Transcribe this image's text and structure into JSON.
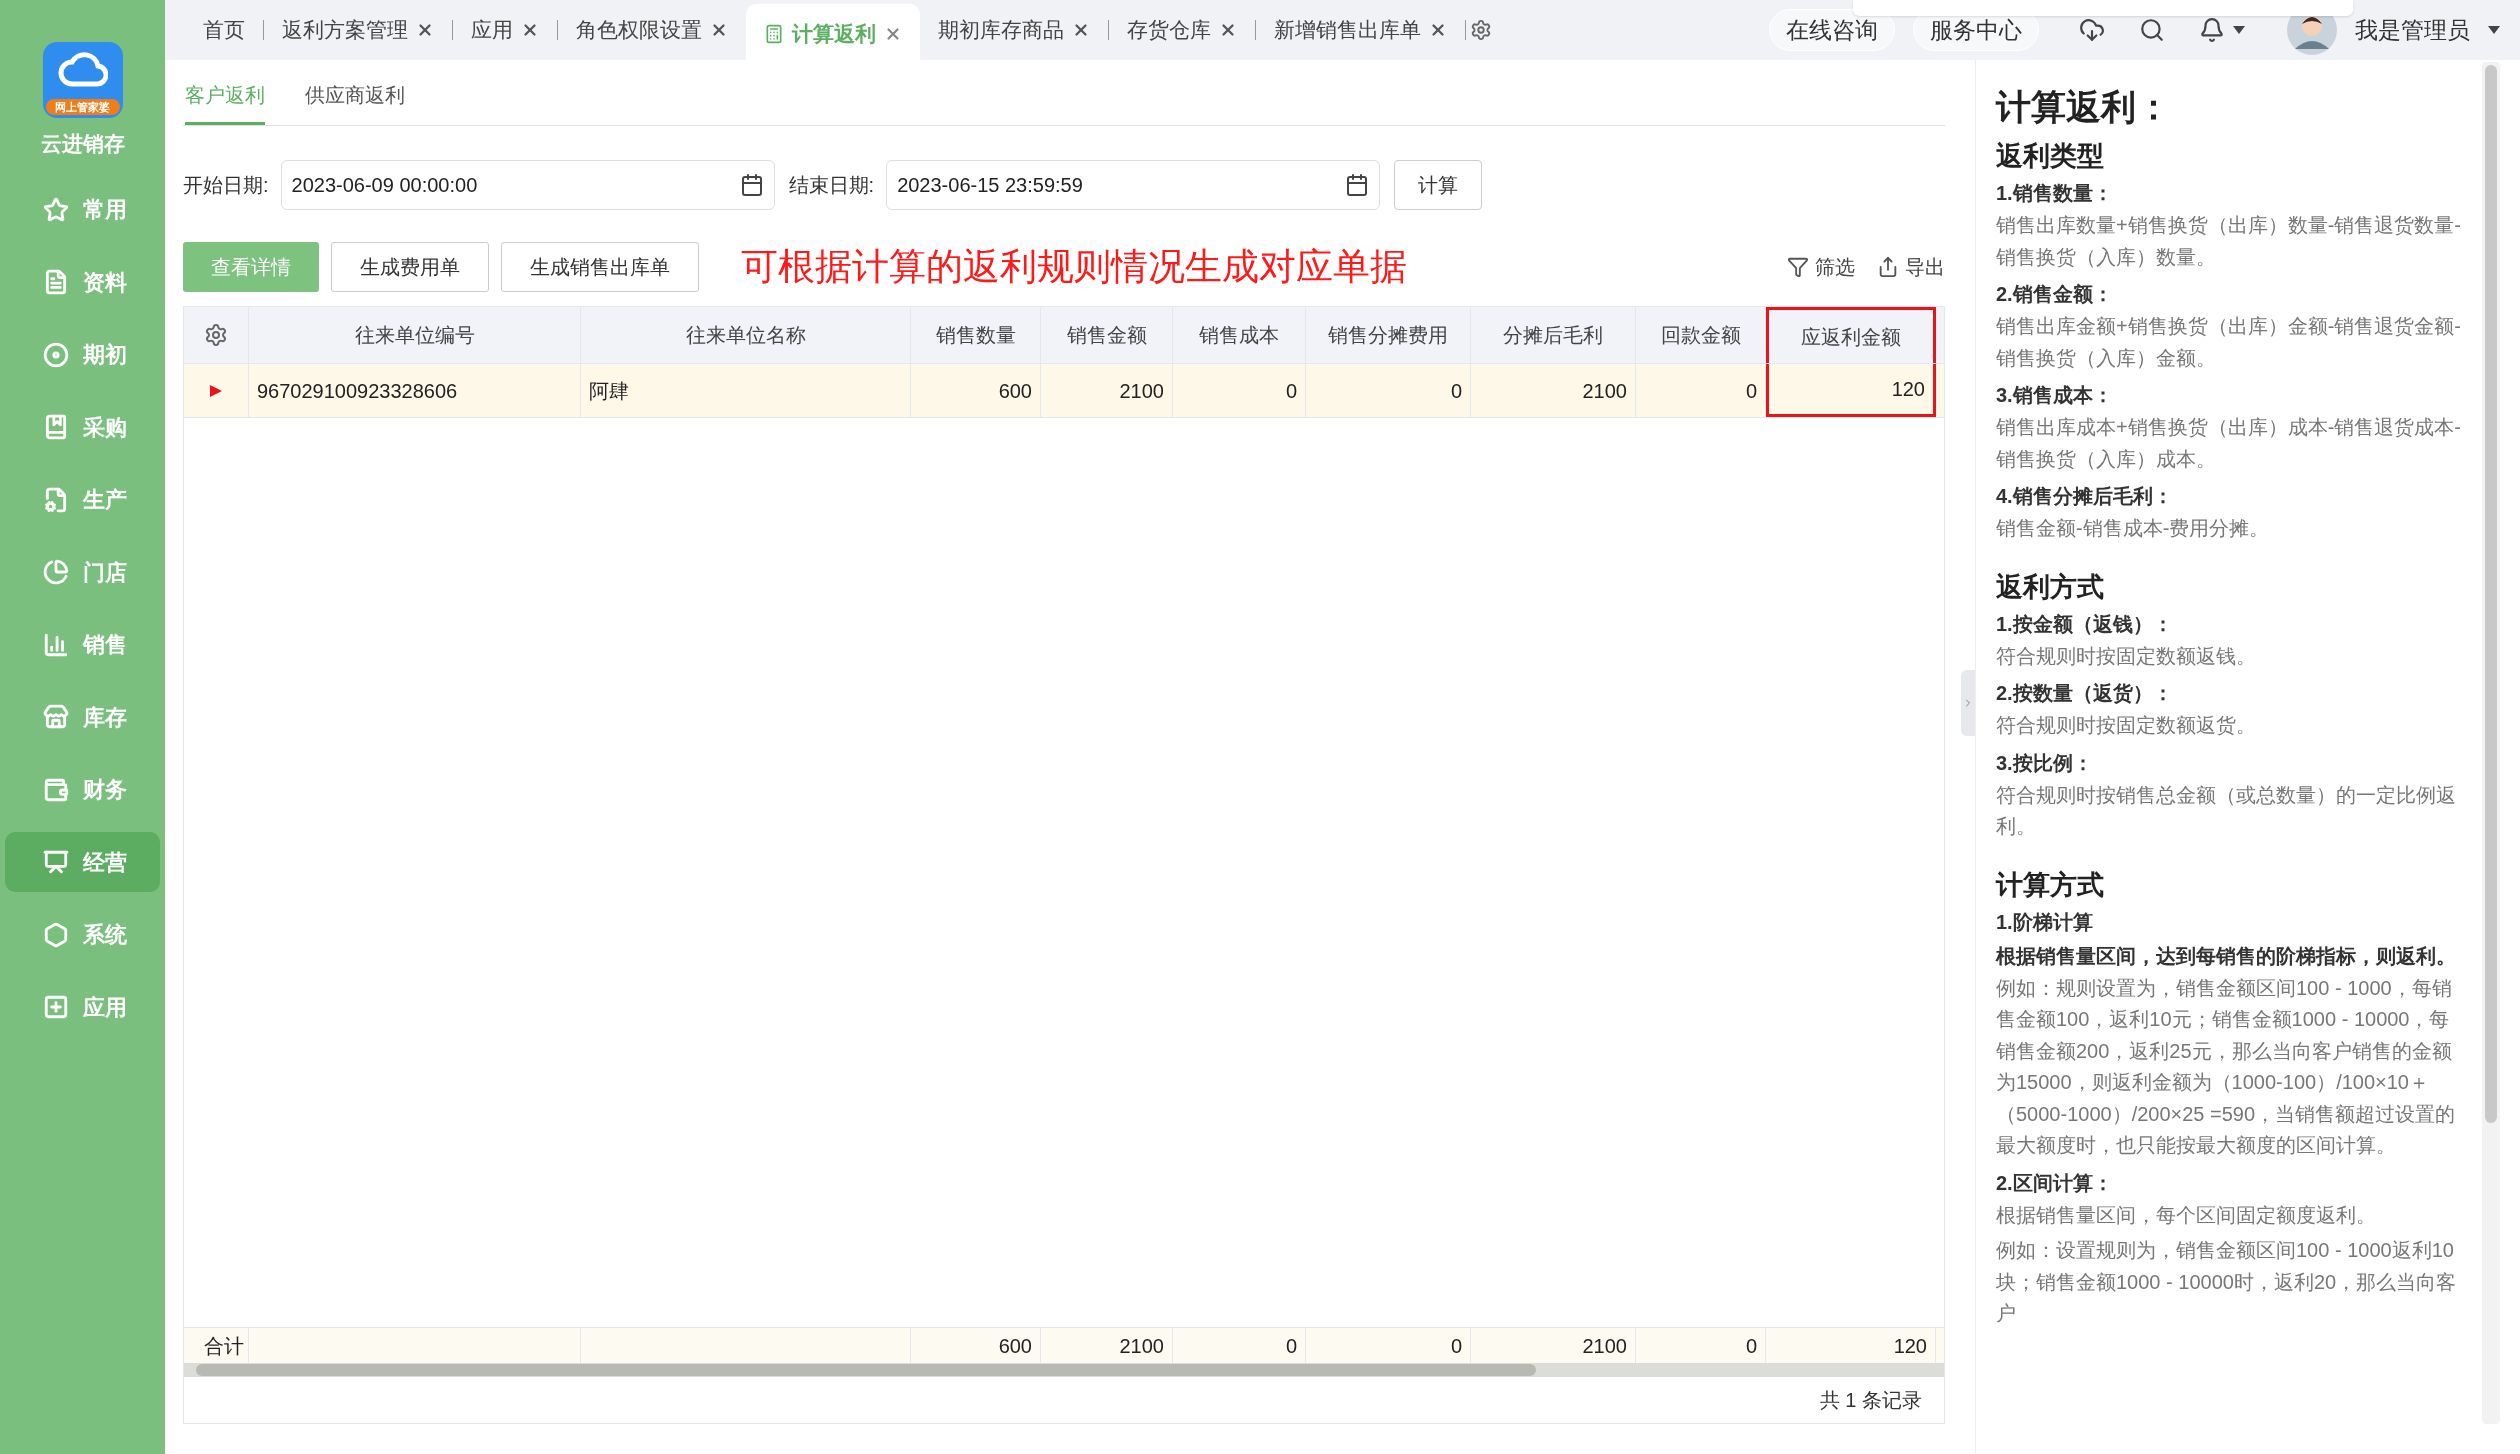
{
  "app": {
    "name": "云进销存",
    "logo_badge": "网上管家婆"
  },
  "nav": [
    {
      "label": "常用",
      "selected": false
    },
    {
      "label": "资料",
      "selected": false
    },
    {
      "label": "期初",
      "selected": false
    },
    {
      "label": "采购",
      "selected": false
    },
    {
      "label": "生产",
      "selected": false
    },
    {
      "label": "门店",
      "selected": false
    },
    {
      "label": "销售",
      "selected": false
    },
    {
      "label": "库存",
      "selected": false
    },
    {
      "label": "财务",
      "selected": false
    },
    {
      "label": "经营",
      "selected": true
    },
    {
      "label": "系统",
      "selected": false
    },
    {
      "label": "应用",
      "selected": false
    }
  ],
  "tabs": [
    {
      "label": "首页",
      "closable": false,
      "selected": false
    },
    {
      "label": "返利方案管理",
      "closable": true,
      "selected": false
    },
    {
      "label": "应用",
      "closable": true,
      "selected": false
    },
    {
      "label": "角色权限设置",
      "closable": true,
      "selected": false
    },
    {
      "label": "计算返利",
      "closable": true,
      "selected": true
    },
    {
      "label": "期初库存商品",
      "closable": true,
      "selected": false
    },
    {
      "label": "存货仓库",
      "closable": true,
      "selected": false
    },
    {
      "label": "新增销售出库单",
      "closable": true,
      "selected": false
    }
  ],
  "header": {
    "consult": "在线咨询",
    "service": "服务中心",
    "user": "我是管理员"
  },
  "subtabs": [
    {
      "label": "客户返利",
      "selected": true
    },
    {
      "label": "供应商返利",
      "selected": false
    }
  ],
  "filters": {
    "start_label": "开始日期:",
    "start_value": "2023-06-09 00:00:00",
    "end_label": "结束日期:",
    "end_value": "2023-06-15 23:59:59",
    "calc_button": "计算"
  },
  "actions": [
    {
      "label": "查看详情",
      "primary": true
    },
    {
      "label": "生成费用单",
      "primary": false
    },
    {
      "label": "生成销售出库单",
      "primary": false
    }
  ],
  "note": "可根据计算的返利规则情况生成对应单据",
  "toolbar": {
    "filter": "筛选",
    "export": "导出"
  },
  "table": {
    "columns": [
      {
        "label": "往来单位编号",
        "numeric": false,
        "highlighted": false
      },
      {
        "label": "往来单位名称",
        "numeric": false,
        "highlighted": false
      },
      {
        "label": "销售数量",
        "numeric": true,
        "highlighted": false
      },
      {
        "label": "销售金额",
        "numeric": true,
        "highlighted": false
      },
      {
        "label": "销售成本",
        "numeric": true,
        "highlighted": false
      },
      {
        "label": "销售分摊费用",
        "numeric": true,
        "highlighted": false
      },
      {
        "label": "分摊后毛利",
        "numeric": true,
        "highlighted": false
      },
      {
        "label": "回款金额",
        "numeric": true,
        "highlighted": false
      },
      {
        "label": "应返利金额",
        "numeric": true,
        "highlighted": true
      }
    ],
    "rows": [
      {
        "selected": true,
        "cells": [
          "967029100923328606",
          "阿肆",
          "600",
          "2100",
          "0",
          "0",
          "2100",
          "0",
          "120"
        ]
      }
    ],
    "totals_label": "合计",
    "totals": [
      "600",
      "2100",
      "0",
      "0",
      "2100",
      "0",
      "120"
    ]
  },
  "record_count": "共 1 条记录",
  "help": {
    "title": "计算返利：",
    "sections": [
      {
        "heading": "返利类型",
        "blocks": [
          {
            "kind": "subhead",
            "text": "1.销售数量："
          },
          {
            "kind": "para",
            "text": "销售出库数量+销售换货（出库）数量-销售退货数量-销售换货（入库）数量。"
          },
          {
            "kind": "subhead",
            "text": "2.销售金额："
          },
          {
            "kind": "para",
            "text": "销售出库金额+销售换货（出库）金额-销售退货金额-销售换货（入库）金额。"
          },
          {
            "kind": "subhead",
            "text": "3.销售成本："
          },
          {
            "kind": "para",
            "text": "销售出库成本+销售换货（出库）成本-销售退货成本-销售换货（入库）成本。"
          },
          {
            "kind": "subhead",
            "text": "4.销售分摊后毛利："
          },
          {
            "kind": "para",
            "text": "销售金额-销售成本-费用分摊。"
          }
        ]
      },
      {
        "heading": "返利方式",
        "blocks": [
          {
            "kind": "subhead",
            "text": "1.按金额（返钱）："
          },
          {
            "kind": "para",
            "text": "符合规则时按固定数额返钱。"
          },
          {
            "kind": "subhead",
            "text": "2.按数量（返货）："
          },
          {
            "kind": "para",
            "text": "符合规则时按固定数额返货。"
          },
          {
            "kind": "subhead",
            "text": "3.按比例："
          },
          {
            "kind": "para",
            "text": "符合规则时按销售总金额（或总数量）的一定比例返利。"
          }
        ]
      },
      {
        "heading": "计算方式",
        "blocks": [
          {
            "kind": "subhead",
            "text": "1.阶梯计算"
          },
          {
            "kind": "subhead",
            "text": "根据销售量区间，达到每销售的阶梯指标，则返利。"
          },
          {
            "kind": "para",
            "text": "例如：规则设置为，销售金额区间100 - 1000，每销售金额100，返利10元；销售金额1000 - 10000，每销售金额200，返利25元，那么当向客户销售的金额为15000，则返利金额为（1000-100）/100×10＋（5000-1000）/200×25 =590，当销售额超过设置的最大额度时，也只能按最大额度的区间计算。"
          },
          {
            "kind": "subhead",
            "text": "2.区间计算："
          },
          {
            "kind": "para",
            "text": "根据销售量区间，每个区间固定额度返利。"
          },
          {
            "kind": "para",
            "text": "例如：设置规则为，销售金额区间100 - 1000返利10块；销售金额1000 - 10000时，返利20，那么当向客户"
          }
        ]
      }
    ]
  }
}
